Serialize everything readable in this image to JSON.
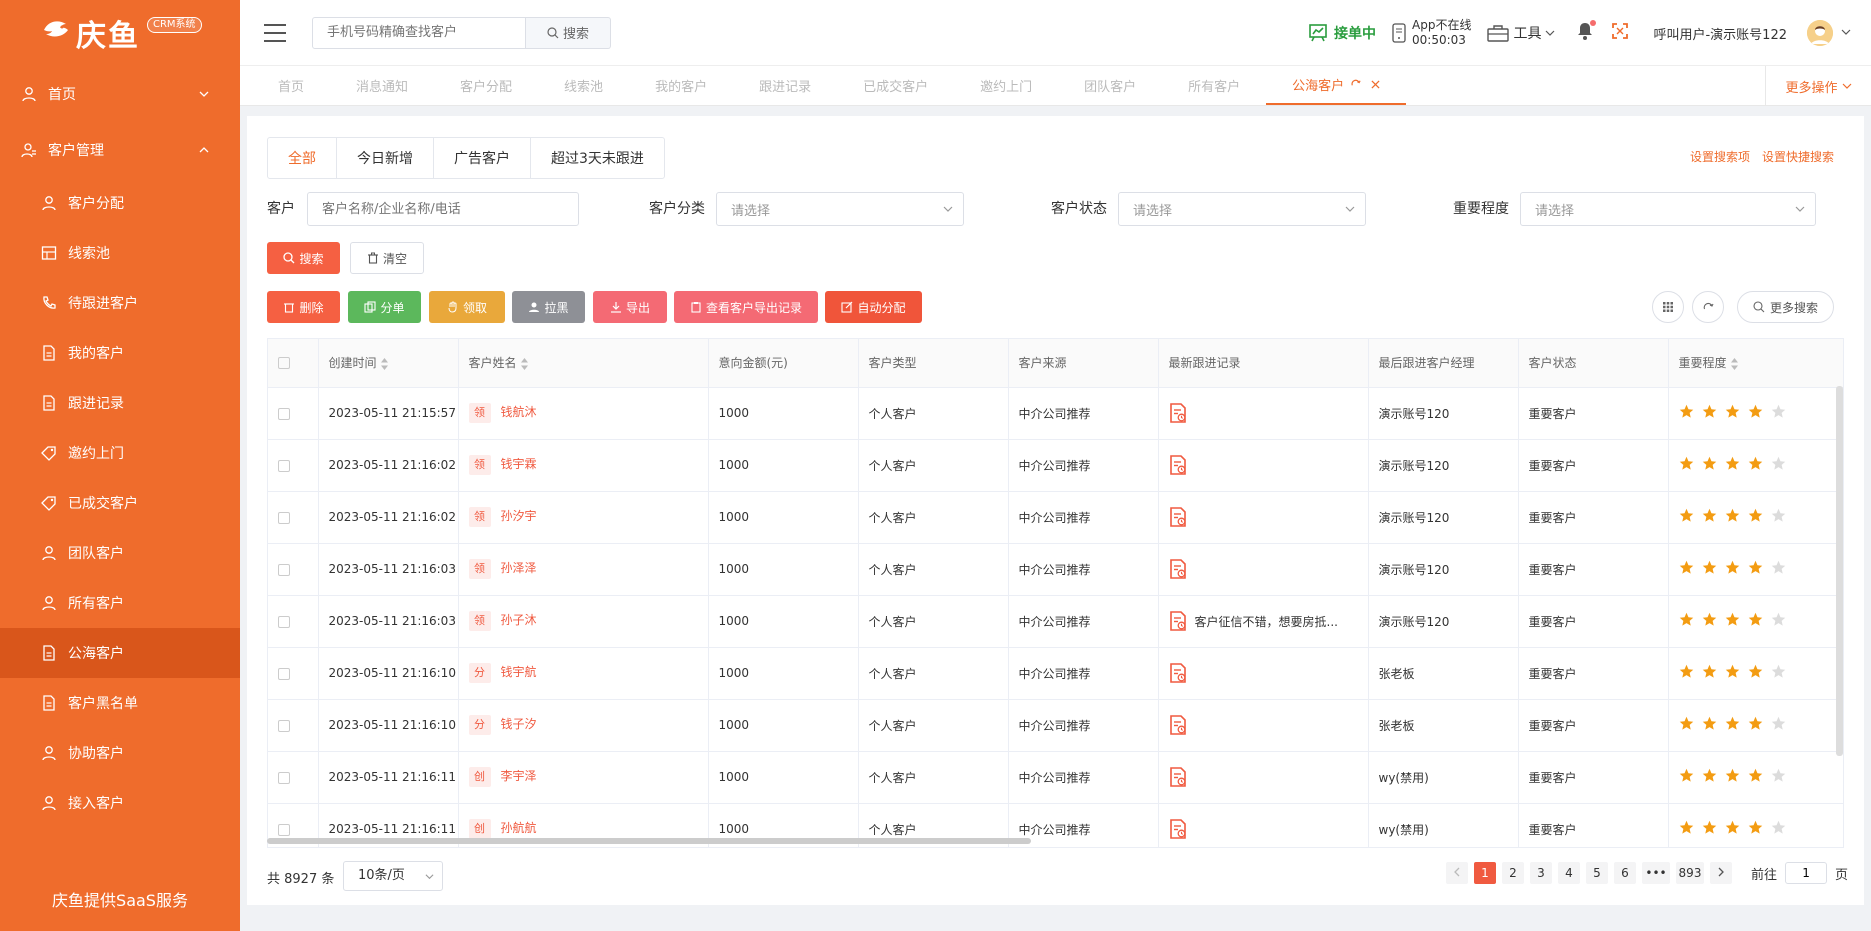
{
  "colors": {
    "primary": "#ef6c2c",
    "active_menu": "#d9561b",
    "accent_red": "#f05a40",
    "status_green": "#2a9d3e",
    "star": "#f39c12"
  },
  "brand": {
    "logo_text": "庆鱼",
    "badge": "CRM系统",
    "footer": "庆鱼提供SaaS服务"
  },
  "sidebar": {
    "items": [
      {
        "label": "首页",
        "icon": "user-icon",
        "type": "top"
      },
      {
        "label": "客户管理",
        "icon": "customer-icon",
        "type": "top"
      },
      {
        "label": "客户分配",
        "icon": "user-icon",
        "type": "sub"
      },
      {
        "label": "线索池",
        "icon": "grid-icon",
        "type": "sub"
      },
      {
        "label": "待跟进客户",
        "icon": "phone-icon",
        "type": "sub"
      },
      {
        "label": "我的客户",
        "icon": "doc-icon",
        "type": "sub"
      },
      {
        "label": "跟进记录",
        "icon": "doc-icon",
        "type": "sub"
      },
      {
        "label": "邀约上门",
        "icon": "tag-icon",
        "type": "sub"
      },
      {
        "label": "已成交客户",
        "icon": "tag-icon",
        "type": "sub"
      },
      {
        "label": "团队客户",
        "icon": "user-icon",
        "type": "sub"
      },
      {
        "label": "所有客户",
        "icon": "user-icon",
        "type": "sub"
      },
      {
        "label": "公海客户",
        "icon": "doc-icon",
        "type": "sub",
        "active": true
      },
      {
        "label": "客户黑名单",
        "icon": "doc-icon",
        "type": "sub"
      },
      {
        "label": "协助客户",
        "icon": "user-icon",
        "type": "sub"
      },
      {
        "label": "接入客户",
        "icon": "user-icon",
        "type": "sub"
      }
    ]
  },
  "header": {
    "search_placeholder": "手机号码精确查找客户",
    "search_button": "搜索",
    "status": "接单中",
    "app_line1": "App不在线",
    "app_line2": "00:50:03",
    "tools": "工具",
    "user": "呼叫用户-演示账号122"
  },
  "tabs": [
    "首页",
    "消息通知",
    "客户分配",
    "线索池",
    "我的客户",
    "跟进记录",
    "已成交客户",
    "邀约上门",
    "团队客户",
    "所有客户",
    "公海客户"
  ],
  "more_ops": "更多操作",
  "filter_tabs": [
    "全部",
    "今日新增",
    "广告客户",
    "超过3天未跟进"
  ],
  "set_links": [
    "设置搜索项",
    "设置快捷搜索"
  ],
  "filters": {
    "customer_label": "客户",
    "customer_placeholder": "客户名称/企业名称/电话",
    "category_label": "客户分类",
    "status_label": "客户状态",
    "importance_label": "重要程度",
    "select_placeholder": "请选择"
  },
  "buttons": {
    "search": "搜索",
    "clear": "清空",
    "delete": "删除",
    "split": "分单",
    "claim": "领取",
    "blacklist": "拉黑",
    "export": "导出",
    "export_log": "查看客户导出记录",
    "auto_assign": "自动分配",
    "more_search": "更多搜索"
  },
  "table": {
    "headers": [
      "创建时间",
      "客户姓名",
      "意向金额(元)",
      "客户类型",
      "客户来源",
      "最新跟进记录",
      "最后跟进客户经理",
      "客户状态",
      "重要程度"
    ],
    "rows": [
      {
        "time": "2023-05-11 21:15:57",
        "tag": "领",
        "name": "钱航沐",
        "amount": "1000",
        "type": "个人客户",
        "source": "中介公司推荐",
        "record": "",
        "manager": "演示账号120",
        "status": "重要客户",
        "stars": 4
      },
      {
        "time": "2023-05-11 21:16:02",
        "tag": "领",
        "name": "钱宇霖",
        "amount": "1000",
        "type": "个人客户",
        "source": "中介公司推荐",
        "record": "",
        "manager": "演示账号120",
        "status": "重要客户",
        "stars": 4
      },
      {
        "time": "2023-05-11 21:16:02",
        "tag": "领",
        "name": "孙汐宇",
        "amount": "1000",
        "type": "个人客户",
        "source": "中介公司推荐",
        "record": "",
        "manager": "演示账号120",
        "status": "重要客户",
        "stars": 4
      },
      {
        "time": "2023-05-11 21:16:03",
        "tag": "领",
        "name": "孙泽泽",
        "amount": "1000",
        "type": "个人客户",
        "source": "中介公司推荐",
        "record": "",
        "manager": "演示账号120",
        "status": "重要客户",
        "stars": 4
      },
      {
        "time": "2023-05-11 21:16:03",
        "tag": "领",
        "name": "孙子沐",
        "amount": "1000",
        "type": "个人客户",
        "source": "中介公司推荐",
        "record": "客户征信不错，想要房抵...",
        "manager": "演示账号120",
        "status": "重要客户",
        "stars": 4
      },
      {
        "time": "2023-05-11 21:16:10",
        "tag": "分",
        "name": "钱宇航",
        "amount": "1000",
        "type": "个人客户",
        "source": "中介公司推荐",
        "record": "",
        "manager": "张老板",
        "status": "重要客户",
        "stars": 4
      },
      {
        "time": "2023-05-11 21:16:10",
        "tag": "分",
        "name": "钱子汐",
        "amount": "1000",
        "type": "个人客户",
        "source": "中介公司推荐",
        "record": "",
        "manager": "张老板",
        "status": "重要客户",
        "stars": 4
      },
      {
        "time": "2023-05-11 21:16:11",
        "tag": "创",
        "name": "李宇泽",
        "amount": "1000",
        "type": "个人客户",
        "source": "中介公司推荐",
        "record": "",
        "manager": "wy(禁用)",
        "status": "重要客户",
        "stars": 4
      },
      {
        "time": "2023-05-11 21:16:11",
        "tag": "创",
        "name": "孙航航",
        "amount": "1000",
        "type": "个人客户",
        "source": "中介公司推荐",
        "record": "",
        "manager": "wy(禁用)",
        "status": "重要客户",
        "stars": 4
      }
    ]
  },
  "pagination": {
    "total": "共 8927 条",
    "page_size": "10条/页",
    "pages": [
      "1",
      "2",
      "3",
      "4",
      "5",
      "6",
      "•••",
      "893"
    ],
    "goto_label": "前往",
    "goto_value": "1",
    "page_suffix": "页"
  }
}
